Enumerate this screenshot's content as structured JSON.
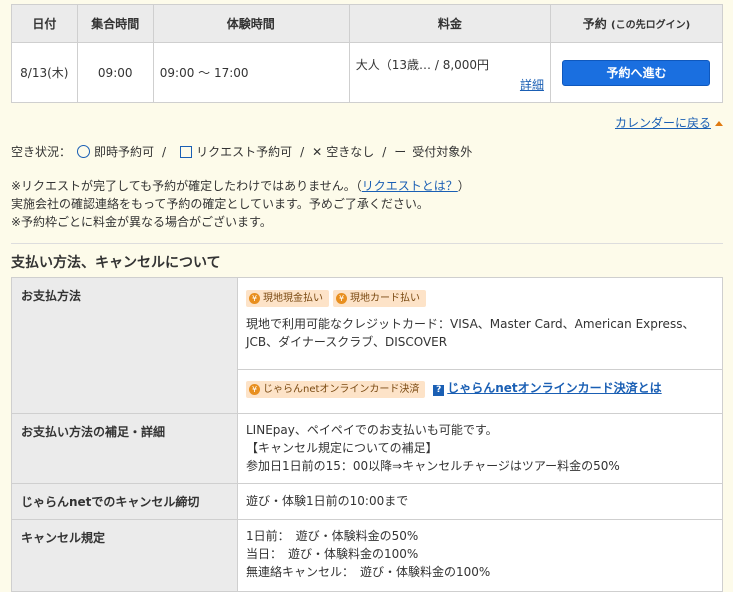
{
  "schedule": {
    "headers": {
      "date": "日付",
      "gather_time": "集合時間",
      "exp_time": "体験時間",
      "fee": "料金",
      "reserve": "予約",
      "reserve_note": "(この先ログイン)"
    },
    "row": {
      "date": "8/13(木)",
      "gather_time": "09:00",
      "exp_time": "09:00 〜 17:00",
      "fee": "大人（13歳… / 8,000円",
      "detail_link": "詳細",
      "reserve_button": "予約へ進む"
    }
  },
  "back_to_calendar": "カレンダーに戻る",
  "legend": {
    "label": "空き状況：",
    "instant": "即時予約可",
    "request": "リクエスト予約可",
    "none_mark": "✕",
    "none": "空きなし",
    "out_mark": "ー",
    "out": "受付対象外",
    "separator": "/"
  },
  "notes": {
    "line1_prefix": "※リクエストが完了しても予約が確定したわけではありません。（",
    "line1_link": "リクエストとは？",
    "line1_suffix": "）",
    "line2": "実施会社の確認連絡をもって予約の確定としています。予めご了承ください。",
    "line3": "※予約枠ごとに料金が異なる場合がございます。"
  },
  "payment_section": {
    "title": "支払い方法、キャンセルについて",
    "rows": {
      "methods": {
        "label": "お支払方法",
        "badge1": "現地現金払い",
        "badge2": "現地カード払い",
        "cards_text": "現地で利用可能なクレジットカード：VISA、Master Card、American Express、JCB、ダイナースクラブ、DISCOVER",
        "online_badge": "じゃらんnetオンラインカード決済",
        "online_link": "じゃらんnetオンラインカード決済とは"
      },
      "supplement": {
        "label": "お支払い方法の補足・詳細",
        "line1": "LINEpay、ペイペイでのお支払いも可能です。",
        "line2": "【キャンセル規定についての補足】",
        "line3": "参加日1日前の15：00以降⇒キャンセルチャージはツアー料金の50%"
      },
      "deadline": {
        "label": "じゃらんnetでのキャンセル締切",
        "value": "遊び・体験1日前の10:00まで"
      },
      "policy": {
        "label": "キャンセル規定",
        "line1": "1日前：　遊び・体験料金の50%",
        "line2": "当日：　遊び・体験料金の100%",
        "line3": "無連絡キャンセル：　遊び・体験料金の100%"
      }
    }
  }
}
